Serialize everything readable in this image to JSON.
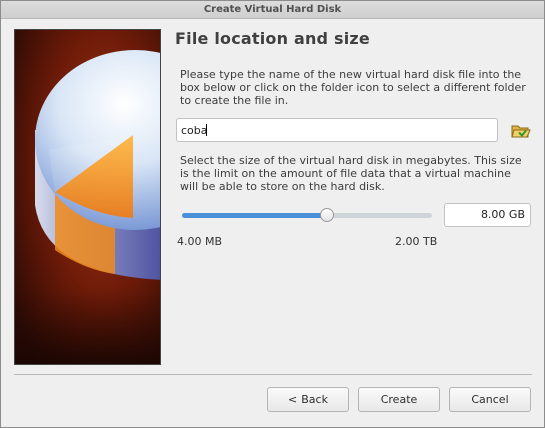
{
  "window": {
    "title": "Create Virtual Hard Disk"
  },
  "page": {
    "heading": "File location and size",
    "location_description": "Please type the name of the new virtual hard disk file into the box below or click on the folder icon to select a different folder to create the file in.",
    "file_name_value": "coba",
    "size_description": "Select the size of the virtual hard disk in megabytes. This size is the limit on the amount of file data that a virtual machine will be able to store on the hard disk.",
    "size_value": "8.00 GB",
    "size_slider_fraction": 0.58,
    "size_min_label": "4.00 MB",
    "size_max_label": "2.00 TB"
  },
  "buttons": {
    "back_arrow": "<",
    "back_label": "Back",
    "create_label": "Create",
    "cancel_label": "Cancel"
  },
  "colors": {
    "slider_fill": "#4a90d9",
    "banner_background": "#6b1a08",
    "disk_highlight": "#f5a623"
  },
  "icons": {
    "folder": "folder-open-icon",
    "banner": "virtual-disk-illustration"
  }
}
